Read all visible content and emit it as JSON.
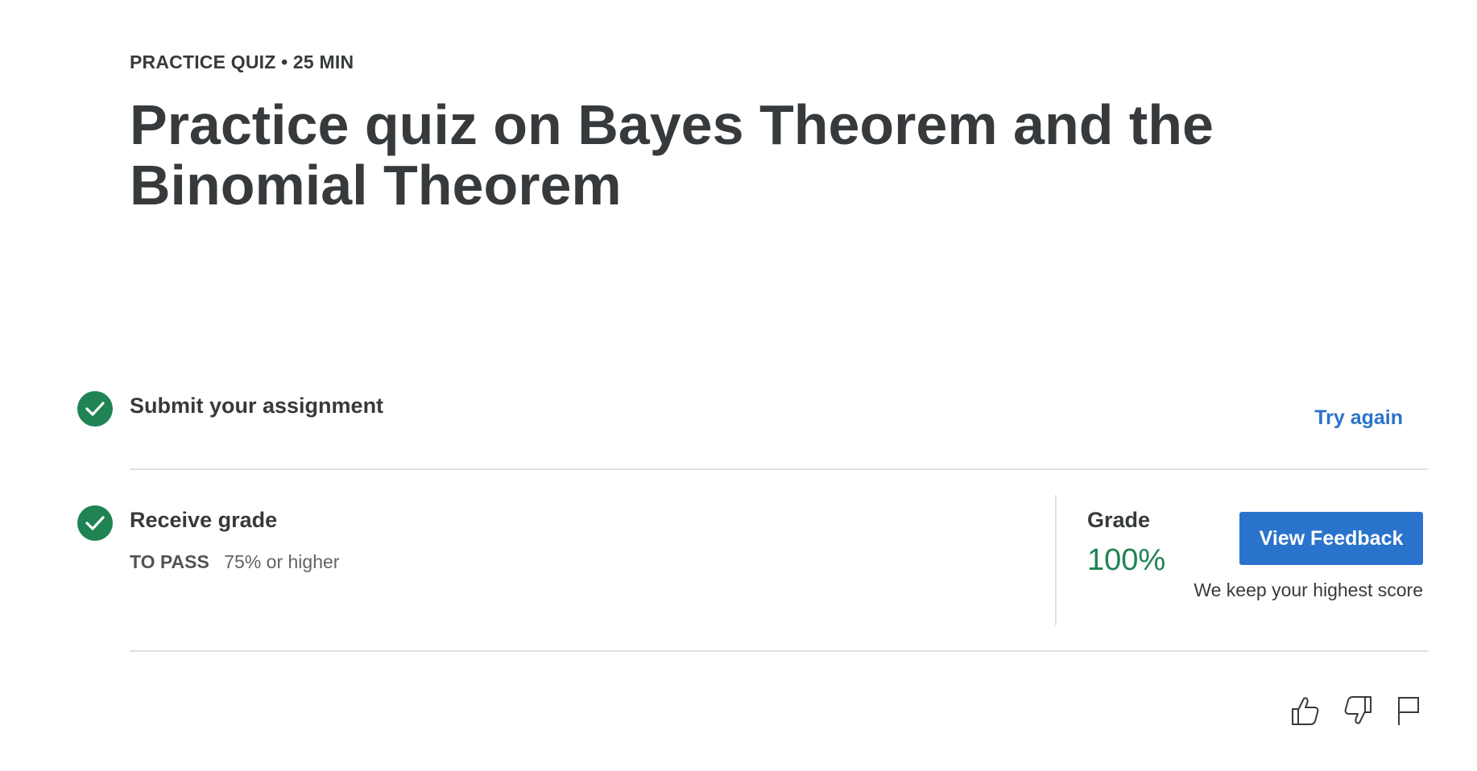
{
  "header": {
    "meta": "PRACTICE QUIZ • 25 MIN",
    "title": "Practice quiz on Bayes Theorem and the Binomial Theorem"
  },
  "steps": {
    "submit": {
      "label": "Submit your assignment",
      "action": "Try again",
      "icon": "check-circle-icon"
    },
    "receive": {
      "label": "Receive grade",
      "to_pass_label": "TO PASS",
      "to_pass_value": "75% or higher",
      "icon": "check-circle-icon"
    }
  },
  "grade": {
    "label": "Grade",
    "value": "100%",
    "button": "View Feedback",
    "note": "We keep your highest score"
  },
  "feedback_icons": [
    "thumbs-up-icon",
    "thumbs-down-icon",
    "flag-icon"
  ],
  "colors": {
    "text": "#373a3c",
    "success": "#1f8354",
    "accent": "#2a73cc",
    "divider": "#e1e1e1"
  }
}
